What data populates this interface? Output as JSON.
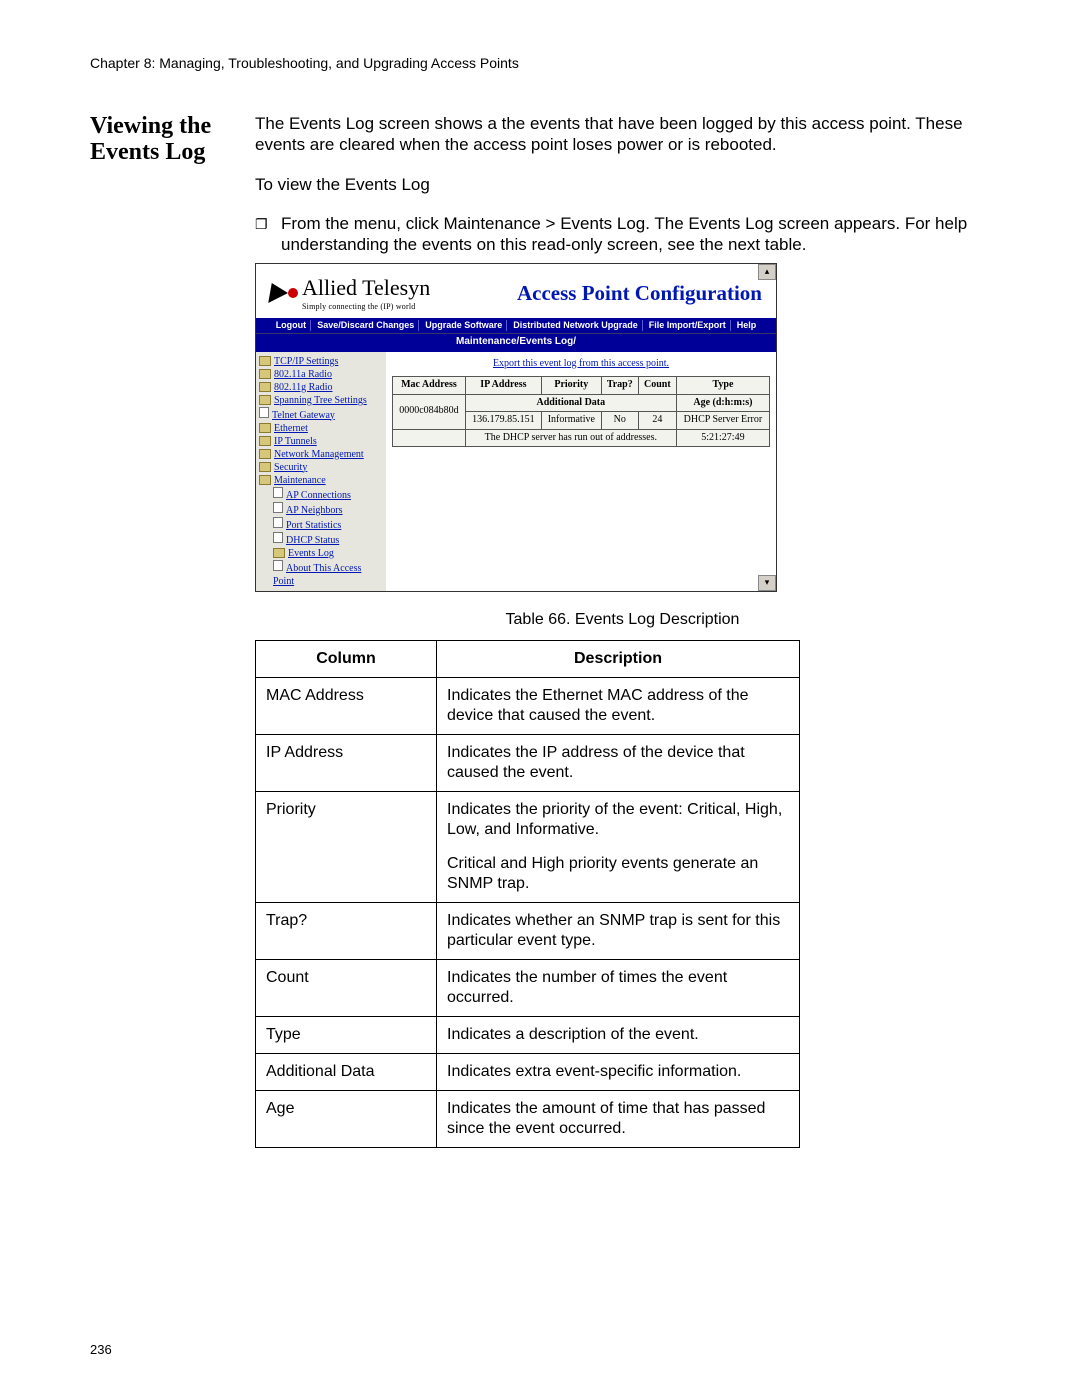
{
  "header": {
    "running_head": "Chapter 8: Managing, Troubleshooting, and Upgrading Access Points"
  },
  "section": {
    "title": "Viewing the Events Log",
    "intro": "The Events Log screen shows a the events that have been logged by this access point. These events are cleared when the access point loses power or is rebooted.",
    "toview": "To view the Events Log",
    "bullet": "From the menu, click Maintenance > Events Log. The Events Log screen appears. For help understanding the events on this read-only screen, see the next table."
  },
  "shot": {
    "brand": "Allied Telesyn",
    "brand_sub": "Simply connecting the (IP) world",
    "title": "Access Point Configuration",
    "menu": [
      "Logout",
      "Save/Discard Changes",
      "Upgrade Software",
      "Distributed Network Upgrade",
      "File Import/Export",
      "Help"
    ],
    "crumb": "Maintenance/Events Log/",
    "nav": [
      {
        "label": "TCP/IP Settings",
        "cls": "closed"
      },
      {
        "label": "802.11a Radio",
        "cls": "closed"
      },
      {
        "label": "802.11g Radio",
        "cls": "closed"
      },
      {
        "label": "Spanning Tree Settings",
        "cls": "closed"
      },
      {
        "label": "Telnet Gateway",
        "cls": "doc"
      },
      {
        "label": "Ethernet",
        "cls": "closed"
      },
      {
        "label": "IP Tunnels",
        "cls": "closed"
      },
      {
        "label": "Network Management",
        "cls": "closed"
      },
      {
        "label": "Security",
        "cls": "closed"
      },
      {
        "label": "Maintenance",
        "cls": "open"
      }
    ],
    "nav_sub": [
      {
        "label": "AP Connections",
        "cls": "doc"
      },
      {
        "label": "AP Neighbors",
        "cls": "doc"
      },
      {
        "label": "Port Statistics",
        "cls": "doc"
      },
      {
        "label": "DHCP Status",
        "cls": "doc"
      },
      {
        "label": "Events Log",
        "cls": "closed"
      },
      {
        "label": "About This Access Point",
        "cls": "doc"
      }
    ],
    "export_link": "Export this event log from this access point.",
    "evt_headers": [
      "Mac Address",
      "IP Address",
      "Priority",
      "Trap?",
      "Count",
      "Type"
    ],
    "evt_sub1": "Additional Data",
    "evt_sub2": "Age (d:h:m:s)",
    "evt_row": {
      "mac": "0000c084b80d",
      "ip": "136.179.85.151",
      "prio": "Informative",
      "trap": "No",
      "count": "24",
      "type": "DHCP Server Error"
    },
    "evt_add": "The DHCP server has run out of addresses.",
    "evt_age": "5:21:27:49"
  },
  "table": {
    "caption": "Table 66. Events Log Description",
    "head": [
      "Column",
      "Description"
    ],
    "rows": [
      {
        "col": "MAC Address",
        "desc": [
          "Indicates the Ethernet MAC address of the device that caused the event."
        ]
      },
      {
        "col": "IP Address",
        "desc": [
          "Indicates the IP address of the device that caused the event."
        ]
      },
      {
        "col": "Priority",
        "desc": [
          "Indicates the priority of the event: Critical, High, Low, and Informative.",
          "Critical and High priority events generate an SNMP trap."
        ]
      },
      {
        "col": "Trap?",
        "desc": [
          "Indicates whether an SNMP trap is sent for this particular event type."
        ]
      },
      {
        "col": "Count",
        "desc": [
          "Indicates the number of times the event occurred."
        ]
      },
      {
        "col": "Type",
        "desc": [
          "Indicates a description of the event."
        ]
      },
      {
        "col": "Additional Data",
        "desc": [
          "Indicates extra event-specific information."
        ]
      },
      {
        "col": "Age",
        "desc": [
          "Indicates the amount of time that has passed since the event occurred."
        ]
      }
    ]
  },
  "page_number": "236"
}
